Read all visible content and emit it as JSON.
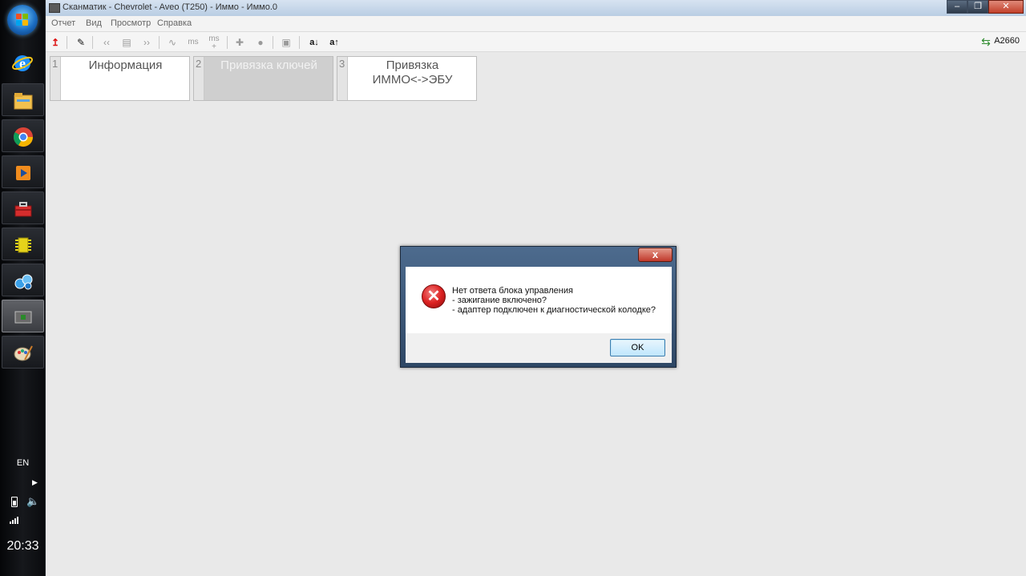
{
  "taskbar": {
    "icons": [
      "windows-start-orb",
      "internet-explorer-icon",
      "file-explorer-icon",
      "chrome-icon",
      "media-player-icon",
      "toolbox-icon",
      "chip-icon",
      "network-app-icon",
      "scanmatik-app-icon",
      "paint-icon"
    ],
    "language": "EN",
    "clock": "20:33"
  },
  "window": {
    "title": "Сканматик - Chevrolet - Aveo (T250) - Иммо - Иммо.0",
    "menu": [
      "Отчет",
      "Вид",
      "Просмотр",
      "Справка"
    ],
    "toolbar": {
      "adapter": "A2660"
    }
  },
  "steps": [
    {
      "num": "1",
      "label": "Информация",
      "enabled": true
    },
    {
      "num": "2",
      "label": "Привязка ключей",
      "enabled": false
    },
    {
      "num": "3",
      "label_line1": "Привязка",
      "label_line2": "ИММО<->ЭБУ",
      "enabled": true
    }
  ],
  "dialog": {
    "close": "x",
    "message_line1": "Нет ответа блока управления",
    "message_line2": "- зажигание включено?",
    "message_line3": "- адаптер подключен к диагностической колодке?",
    "ok_label": "OK"
  },
  "colors": {
    "dialog_frame": "#2e4765",
    "error_red": "#d22222",
    "ok_button_border": "#3c7fb1"
  }
}
